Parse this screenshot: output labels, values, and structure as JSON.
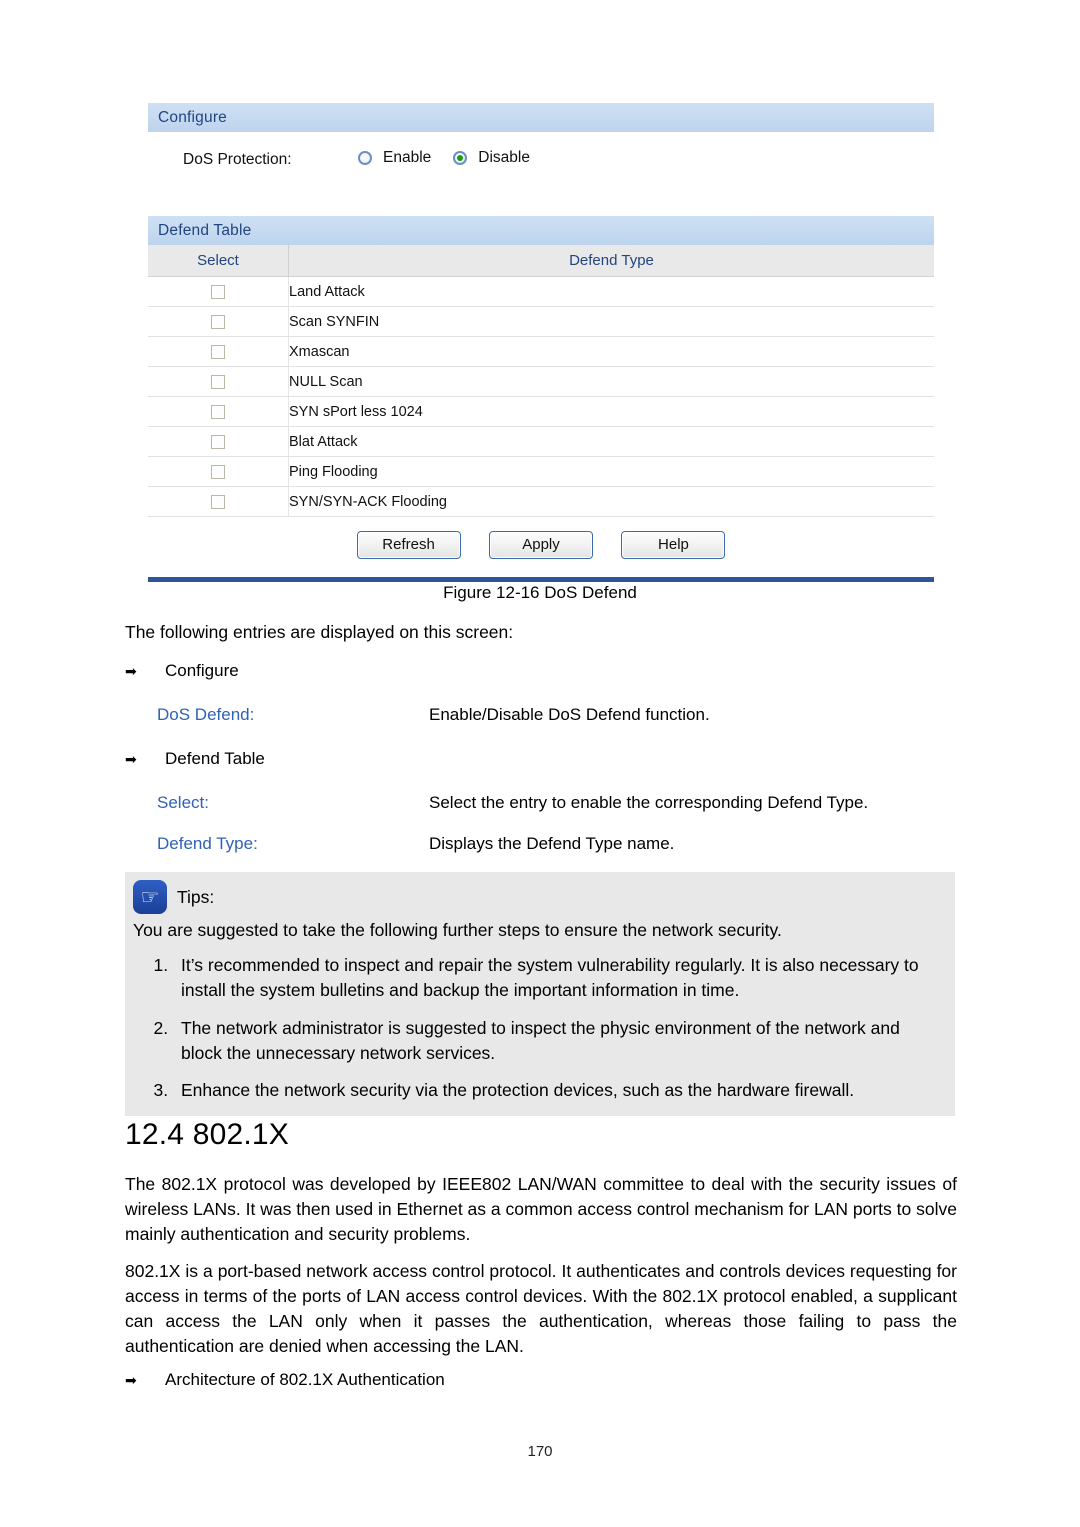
{
  "figure": {
    "configure_panel": {
      "header": "Configure",
      "dos_protection_label": "DoS Protection:",
      "options": [
        {
          "label": "Enable",
          "selected": false
        },
        {
          "label": "Disable",
          "selected": true
        }
      ]
    },
    "defend_table": {
      "header": "Defend Table",
      "columns": [
        "Select",
        "Defend Type"
      ],
      "rows": [
        {
          "selected": false,
          "defend_type": "Land Attack"
        },
        {
          "selected": false,
          "defend_type": "Scan SYNFIN"
        },
        {
          "selected": false,
          "defend_type": "Xmascan"
        },
        {
          "selected": false,
          "defend_type": "NULL Scan"
        },
        {
          "selected": false,
          "defend_type": "SYN sPort less 1024"
        },
        {
          "selected": false,
          "defend_type": "Blat Attack"
        },
        {
          "selected": false,
          "defend_type": "Ping Flooding"
        },
        {
          "selected": false,
          "defend_type": "SYN/SYN-ACK Flooding"
        }
      ]
    },
    "buttons": [
      {
        "label": "Refresh"
      },
      {
        "label": "Apply"
      },
      {
        "label": "Help"
      }
    ],
    "caption": "Figure 12-16 DoS Defend"
  },
  "document": {
    "intro": "The following entries are displayed on this screen:",
    "bullets": {
      "configure": "Configure",
      "defend_table": "Defend Table",
      "architecture": "Architecture of 802.1X Authentication"
    },
    "entries": [
      {
        "term": "DoS Defend:",
        "description": "Enable/Disable DoS Defend function."
      },
      {
        "term": "Select:",
        "description": "Select the entry to enable the corresponding Defend Type."
      },
      {
        "term": "Defend Type:",
        "description": "Displays the Defend Type name."
      }
    ],
    "tips": {
      "icon": "pointing-hand-icon",
      "title": "Tips:",
      "lead": "You are suggested to take the following further steps to ensure the network security.",
      "items": [
        "It’s recommended to inspect and repair the system vulnerability regularly. It is also necessary to install the system bulletins and backup the important information in time.",
        "The network administrator is suggested to inspect the physic environment of the network and block the unnecessary network services.",
        "Enhance the network security via the protection devices, such as the hardware firewall."
      ]
    },
    "section": {
      "heading": "12.4 802.1X",
      "paragraph_1": "The 802.1X protocol was developed by IEEE802 LAN/WAN committee to deal with the security issues of wireless LANs. It was then used in Ethernet as a common access control mechanism for LAN ports to solve mainly authentication and security problems.",
      "paragraph_2": "802.1X is a port-based network access control protocol. It authenticates and controls devices requesting for access in terms of the ports of LAN access control devices. With the 802.1X protocol enabled, a supplicant can access the LAN only when it passes the authentication, whereas those failing to pass the authentication are denied when accessing the LAN."
    },
    "page_number": "170",
    "colors": {
      "panel_header": "#c3d9ef",
      "header_text": "#23457f",
      "accent_rule": "#2c5698",
      "term_blue": "#2f62b5",
      "radio_selected_dot": "#16a016",
      "tips_background": "#e8e8e8",
      "tips_icon": "#1b3f96"
    }
  }
}
